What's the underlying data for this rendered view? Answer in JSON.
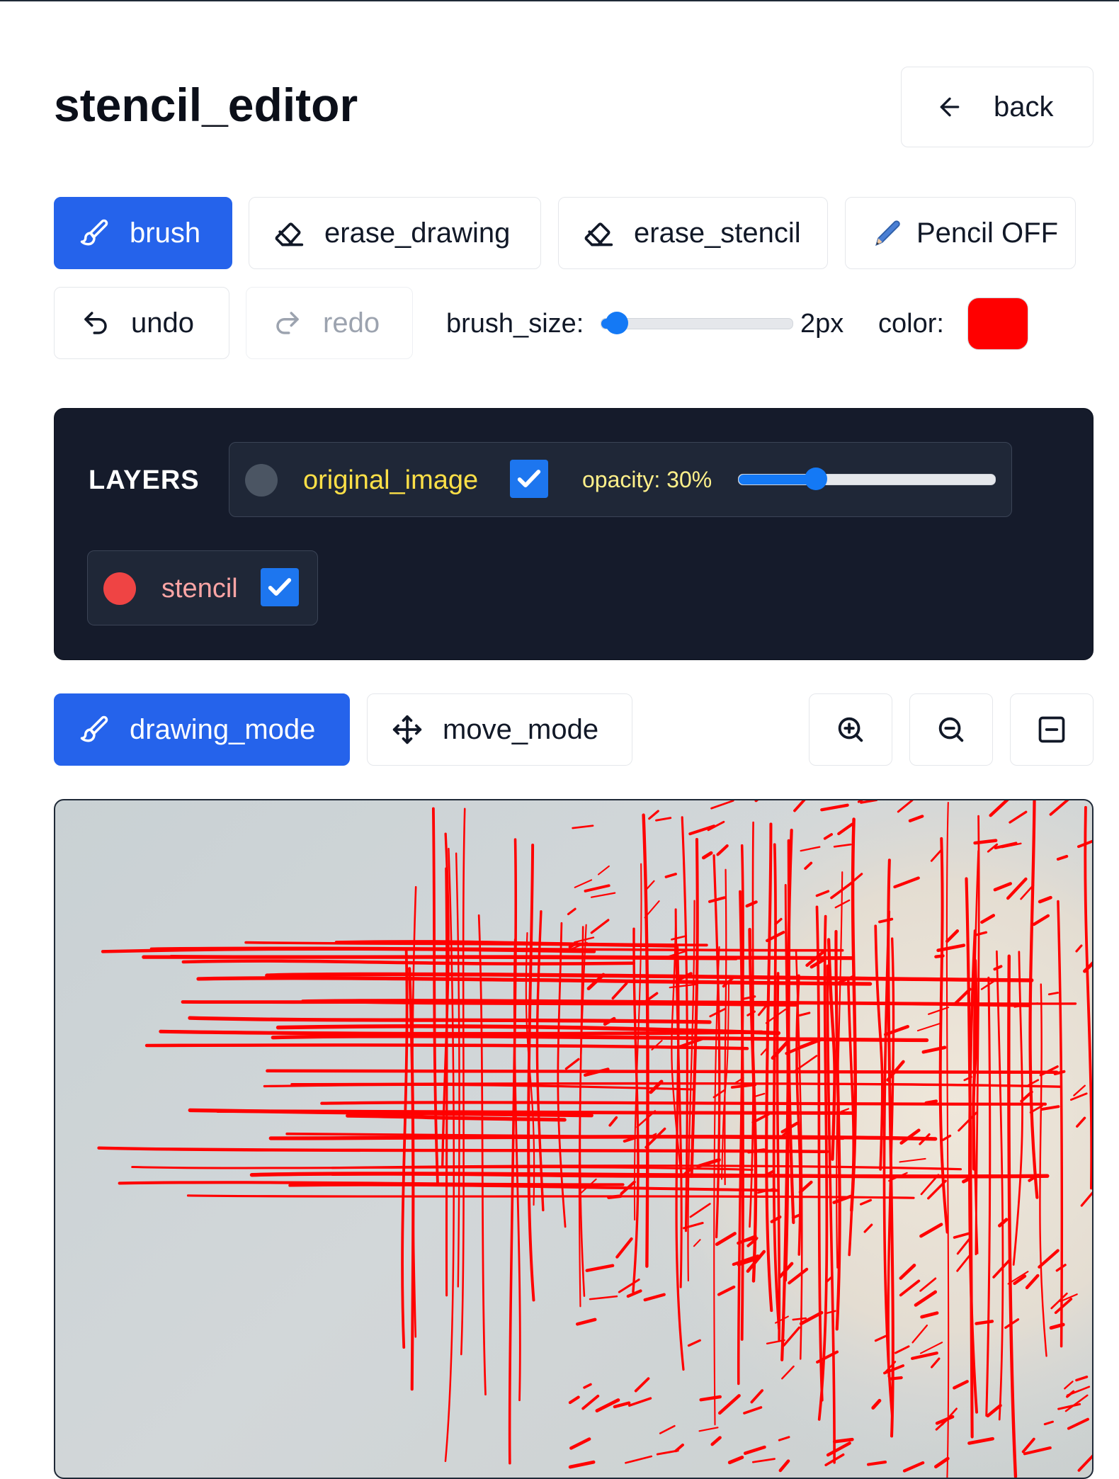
{
  "header": {
    "title": "stencil_editor",
    "back_label": "back"
  },
  "tools": {
    "brush_label": "brush",
    "erase_drawing_label": "erase_drawing",
    "erase_stencil_label": "erase_stencil",
    "pencil_label": "Pencil OFF",
    "undo_label": "undo",
    "redo_label": "redo",
    "brush_size_label": "brush_size:",
    "brush_size_value": "2px",
    "brush_size_fraction": 0.08,
    "color_label": "color:",
    "color_value": "#ff0000"
  },
  "layers": {
    "title": "LAYERS",
    "items": [
      {
        "name": "original_image",
        "visible": true,
        "opacity_label": "opacity: 30%",
        "opacity": 0.3,
        "name_color": "#fde047",
        "dot_color": "#4b5563"
      },
      {
        "name": "stencil",
        "visible": true,
        "name_color": "#fca5a5",
        "dot_color": "#ef4444"
      }
    ]
  },
  "modes": {
    "drawing_label": "drawing_mode",
    "move_label": "move_mode"
  },
  "colors": {
    "accent": "#2563eb",
    "panel": "#151b2b",
    "stroke": "#ff0000"
  }
}
